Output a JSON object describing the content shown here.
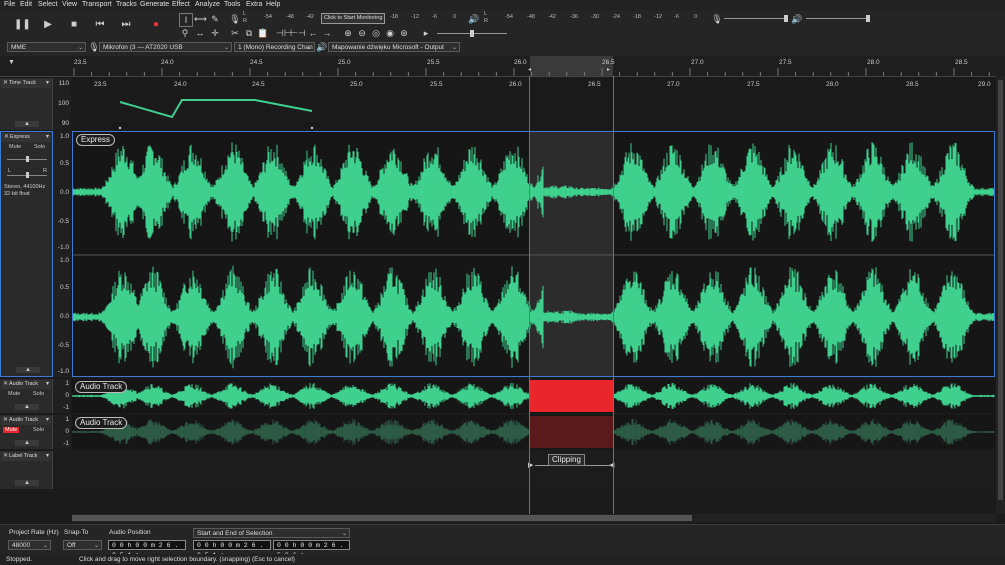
{
  "menu": [
    "File",
    "Edit",
    "Select",
    "View",
    "Transport",
    "Tracks",
    "Generate",
    "Effect",
    "Analyze",
    "Tools",
    "Extra",
    "Help"
  ],
  "monitor_tip": "Click to Start Monitoring",
  "meter_scale_rec": [
    "-54",
    "-48",
    "-42",
    "-18",
    "-12",
    "-6",
    "0"
  ],
  "meter_scale_play": [
    "-54",
    "-48",
    "-42",
    "-36",
    "-30",
    "-24",
    "-18",
    "-12",
    "-6",
    "0"
  ],
  "device": {
    "host": "MME",
    "input": "Mikrofon (3 — AT2020 USB",
    "channels": "1 (Mono) Recording Chan",
    "output": "Mapowanie dźwięku Microsoft - Output"
  },
  "ruler": [
    "23.5",
    "24.0",
    "24.5",
    "25.0",
    "25.5",
    "26.0",
    "26.5",
    "27.0",
    "27.5",
    "28.0",
    "28.5"
  ],
  "time_track": {
    "name": "Time Track",
    "scale": [
      "110",
      "100",
      "90"
    ],
    "ruler": [
      "23.5",
      "24.0",
      "24.5",
      "25.0",
      "25.5",
      "26.0",
      "26.5",
      "27.0",
      "27.5",
      "28.0",
      "28.5",
      "29.0"
    ]
  },
  "express_track": {
    "name": "Express",
    "label": "Express",
    "mute": "Mute",
    "solo": "Solo",
    "gain_l": "L",
    "gain_r": "R",
    "info1": "Stereo, 44100Hz",
    "info2": "32-bit float",
    "scale": [
      "1.0",
      "0.5",
      "0.0",
      "-0.5",
      "-1.0"
    ]
  },
  "audio_track_1": {
    "name": "Audio Track",
    "label": "Audio Track",
    "mute": "Mute",
    "solo": "Solo",
    "scale": [
      "1",
      "0",
      "-1"
    ]
  },
  "audio_track_2": {
    "name": "Audio Track",
    "label": "Audio Track",
    "mute": "Mute",
    "solo": "Solo",
    "scale": [
      "1",
      "0",
      "-1"
    ]
  },
  "label_track": {
    "name": "Label Track",
    "label": "Clipping"
  },
  "selection_bar": {
    "rate_label": "Project Rate (Hz)",
    "rate_value": "48000",
    "snap_label": "Snap-To",
    "snap_value": "Off",
    "pos_label": "Audio Position",
    "pos_value": "0 0 h 0 0 m 2 6 . 0 5 1 s",
    "sel_label": "Start and End of Selection",
    "start_value": "0 0 h 0 0 m 2 6 . 0 5 1 s",
    "end_value": "0 0 h 0 0 m 2 6 . 5 2 6 s"
  },
  "status": {
    "state": "Stopped.",
    "hint": "Click and drag to move right selection boundary. (snapping) (Esc to cancel)"
  },
  "colors": {
    "wave": "#3fd08e",
    "selection": "#2d2d2d",
    "clip": "#e8262b",
    "accent": "#3a7bd5"
  }
}
